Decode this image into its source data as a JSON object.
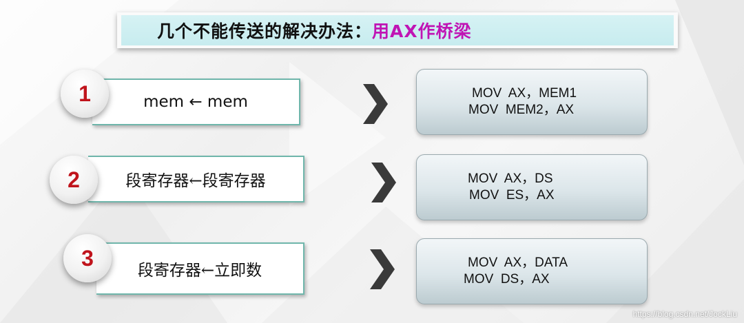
{
  "title": {
    "prefix": "几个不能传送的解决办法：",
    "highlight": "用AX作桥梁",
    "highlight_color": "#c014b4"
  },
  "items": [
    {
      "number": "1",
      "problem": "mem ← mem",
      "solution": [
        "MOV  AX，MEM1",
        "MOV  MEM2，AX"
      ]
    },
    {
      "number": "2",
      "problem": "段寄存器←段寄存器",
      "solution": [
        "MOV  AX，DS",
        "MOV  ES，AX"
      ]
    },
    {
      "number": "3",
      "problem": "段寄存器←立即数",
      "solution": [
        "MOV  AX，DATA",
        "MOV  DS，AX"
      ]
    }
  ],
  "colors": {
    "number": "#c0141c",
    "problem_border": "#6fb6ab",
    "chevron": "#3a3a3a"
  },
  "icons": {
    "arrow": "chevron-right-icon"
  },
  "watermark": "https://blog.csdn.net/JockLiu"
}
